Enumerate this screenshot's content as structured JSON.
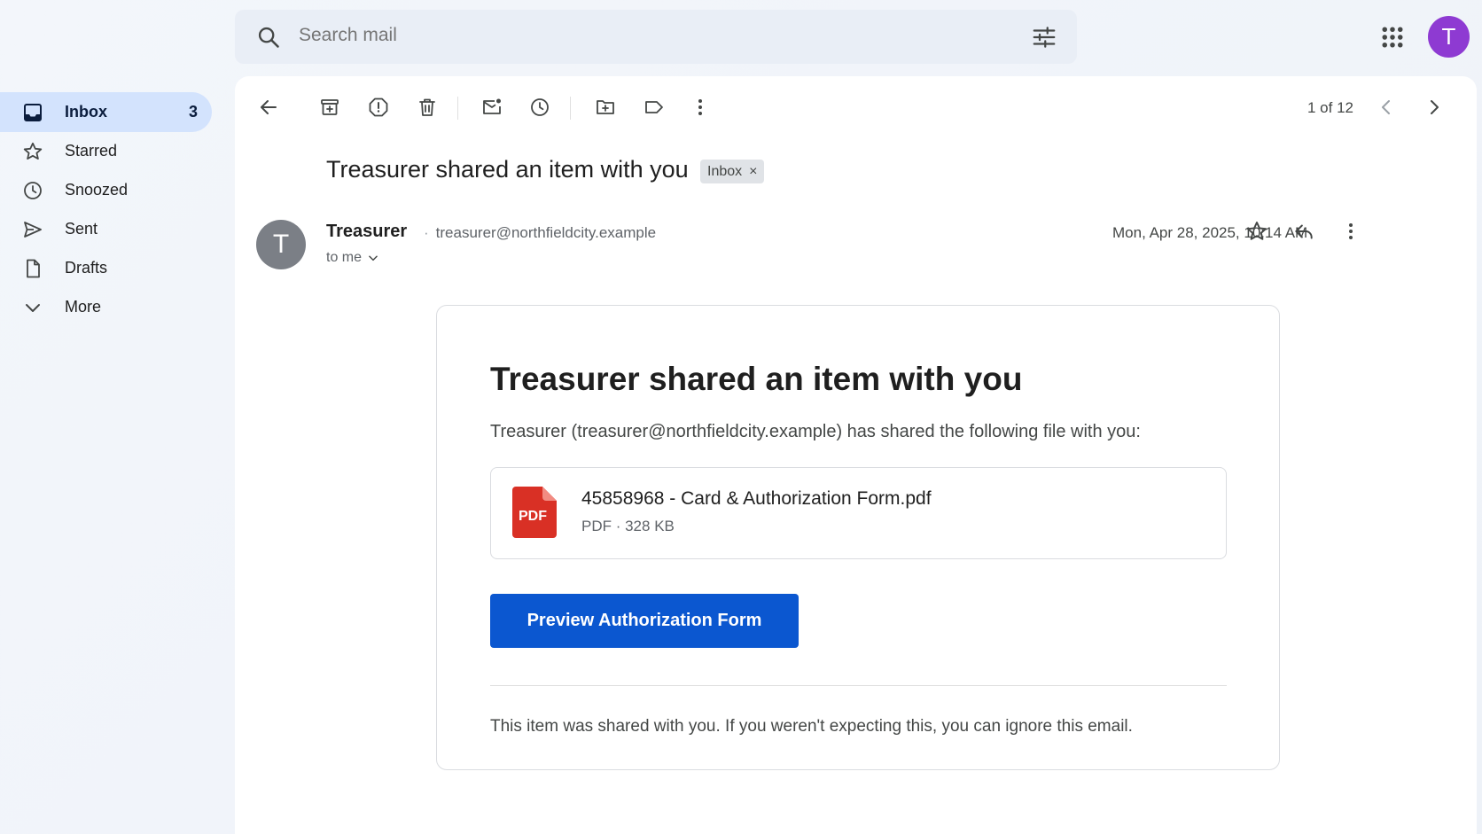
{
  "search": {
    "placeholder": "Search mail"
  },
  "account": {
    "avatar_letter": "T",
    "avatar_color": "#8e3ad2"
  },
  "sidebar": {
    "items": [
      {
        "label": "Inbox",
        "count": "3",
        "icon": "inbox-icon",
        "active": true
      },
      {
        "label": "Starred",
        "icon": "star-icon"
      },
      {
        "label": "Snoozed",
        "icon": "clock-icon"
      },
      {
        "label": "Sent",
        "icon": "send-icon"
      },
      {
        "label": "Drafts",
        "icon": "draft-icon"
      },
      {
        "label": "More",
        "icon": "chevron-down-icon"
      }
    ]
  },
  "toolbar": {
    "icons": [
      "back-arrow-icon",
      "archive-icon",
      "report-spam-icon",
      "delete-icon",
      "mark-unread-icon",
      "snooze-icon",
      "move-to-icon",
      "label-icon",
      "more-vert-icon"
    ],
    "pager": "1 of 12"
  },
  "message": {
    "subject": "Treasurer shared an item with you",
    "label_chip": "Inbox",
    "label_chip_close": "×",
    "sender_initial": "T",
    "sender_name": "Treasurer",
    "sender_email": "treasurer@northfieldcity.example",
    "to": "to me",
    "date": "Mon, Apr 28, 2025, 10:14 AM"
  },
  "body": {
    "title": "Treasurer shared an item with you",
    "description": "Treasurer (treasurer@northfieldcity.example) has shared the following file with you:",
    "file": {
      "icon_text": "PDF",
      "name": "45858968 - Card & Authorization Form.pdf",
      "meta": "PDF · 328 KB"
    },
    "button_label": "Preview Authorization Form",
    "footer": "This item was shared with you. If you weren't expecting this, you can ignore this email."
  },
  "colors": {
    "accent": "#0b57d0",
    "active_nav": "#d3e3fd",
    "pdf_red": "#d93025"
  }
}
